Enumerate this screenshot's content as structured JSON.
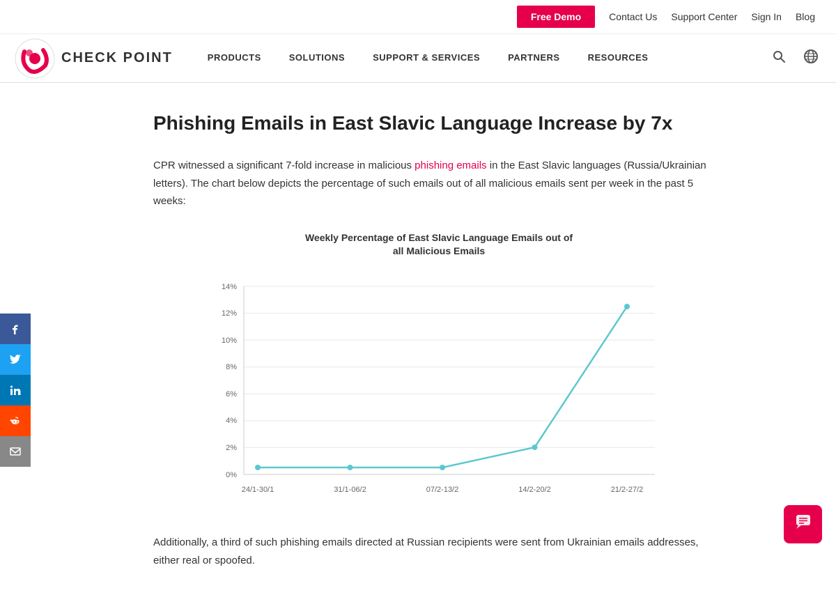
{
  "topbar": {
    "free_demo_label": "Free Demo",
    "contact_us": "Contact Us",
    "support_center": "Support Center",
    "sign_in": "Sign In",
    "blog": "Blog"
  },
  "logo": {
    "text": "CHECK POINT"
  },
  "nav": {
    "items": [
      {
        "label": "PRODUCTS"
      },
      {
        "label": "SOLUTIONS"
      },
      {
        "label": "SUPPORT & SERVICES"
      },
      {
        "label": "PARTNERS"
      },
      {
        "label": "RESOURCES"
      }
    ]
  },
  "article": {
    "title": "Phishing Emails in East Slavic Language Increase by 7x",
    "intro_prefix": "CPR witnessed a significant  7-fold increase in malicious ",
    "phishing_link_text": "phishing emails",
    "intro_suffix": " in the East Slavic languages (Russia/Ukrainian letters). The chart below depicts the percentage of such emails out of all malicious emails sent per week in the past 5 weeks:",
    "chart_title_line1": "Weekly Percentage of East Slavic Language Emails out of",
    "chart_title_line2": "all Malicious Emails",
    "chart": {
      "y_labels": [
        "14%",
        "12%",
        "10%",
        "8%",
        "6%",
        "4%",
        "2%",
        "0%"
      ],
      "x_labels": [
        "24/1-30/1",
        "31/1-06/2",
        "07/2-13/2",
        "14/2-20/2",
        "21/2-27/2"
      ],
      "data_points": [
        {
          "x": 0,
          "y_pct": 0.5
        },
        {
          "x": 1,
          "y_pct": 0.5
        },
        {
          "x": 2,
          "y_pct": 0.5
        },
        {
          "x": 3,
          "y_pct": 2.0
        },
        {
          "x": 4,
          "y_pct": 12.5
        }
      ]
    },
    "footer_text": "Additionally, a third of such phishing emails directed at Russian recipients were sent from Ukrainian emails addresses, either real or spoofed."
  },
  "social": {
    "facebook_icon": "f",
    "twitter_icon": "t",
    "linkedin_icon": "in",
    "reddit_icon": "r",
    "email_icon": "✉"
  },
  "colors": {
    "brand_red": "#e6004c",
    "link_color": "#e6004c",
    "chart_line": "#5bc8d0",
    "chart_dot": "#5bc8d0"
  }
}
